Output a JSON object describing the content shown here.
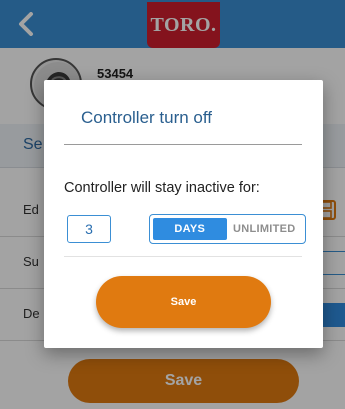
{
  "brand": {
    "logo_text": "TORO.",
    "logo_color": "#cf1f2e",
    "header_color": "#3b8fd4"
  },
  "device": {
    "id": "53454"
  },
  "background_screen": {
    "section_header_visible": "Se",
    "rows": [
      {
        "label_visible": "Ed",
        "trailing_icon": "save-icon"
      },
      {
        "label_visible": "Su",
        "trailing_icon": "toggle"
      },
      {
        "label_visible": "De",
        "trailing_icon": "toggle"
      }
    ],
    "save_label": "Save"
  },
  "dialog": {
    "title": "Controller turn off",
    "message": "Controller will stay inactive for:",
    "quantity_value": "3",
    "unit_options": [
      "DAYS",
      "UNLIMITED"
    ],
    "selected_unit": "DAYS",
    "save_label": "Save"
  },
  "colors": {
    "accent": "#2f8ce0",
    "primary_action": "#e07a10"
  }
}
